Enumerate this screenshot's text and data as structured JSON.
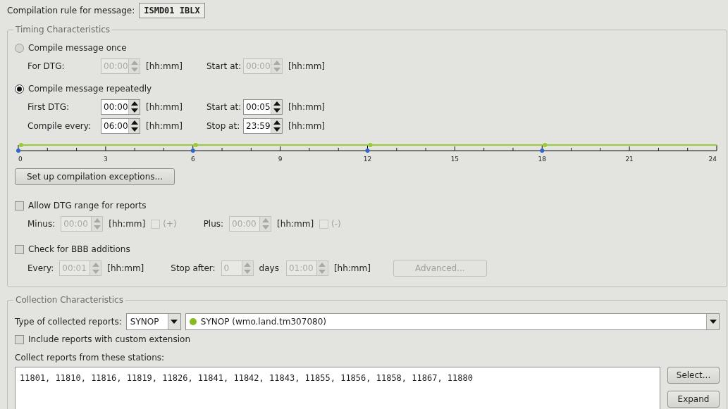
{
  "header": {
    "label": "Compilation rule for message:",
    "value": "ISMD01 IBLX"
  },
  "timing": {
    "title": "Timing Characteristics",
    "modes": [
      {
        "label": "Compile message once",
        "selected": false,
        "rows": [
          [
            {
              "label": "For DTG:",
              "value": "00:00",
              "unit": "[hh:mm]",
              "disabled": true
            },
            {
              "label": "Start at:",
              "value": "00:00",
              "unit": "[hh:mm]",
              "disabled": true
            }
          ]
        ]
      },
      {
        "label": "Compile message repeatedly",
        "selected": true,
        "rows": [
          [
            {
              "label": "First DTG:",
              "value": "00:00",
              "unit": "[hh:mm]",
              "disabled": false
            },
            {
              "label": "Start at:",
              "value": "00:05",
              "unit": "[hh:mm]",
              "disabled": false
            }
          ],
          [
            {
              "label": "Compile every:",
              "value": "06:00",
              "unit": "[hh:mm]",
              "disabled": false
            },
            {
              "label": "Stop at:",
              "value": "23:59",
              "unit": "[hh:mm]",
              "disabled": false
            }
          ]
        ]
      }
    ],
    "timeline": {
      "ticks": [
        {
          "label": "0",
          "scheduled": true
        },
        {
          "label": "3",
          "scheduled": false
        },
        {
          "label": "6",
          "scheduled": true
        },
        {
          "label": "9",
          "scheduled": false
        },
        {
          "label": "12",
          "scheduled": true
        },
        {
          "label": "15",
          "scheduled": false
        },
        {
          "label": "18",
          "scheduled": true
        },
        {
          "label": "21",
          "scheduled": false
        },
        {
          "label": "24",
          "scheduled": false
        }
      ]
    },
    "exceptions_button": "Set up compilation exceptions...",
    "options": [
      {
        "label": "Allow DTG range for reports",
        "checked": false,
        "fields": [
          {
            "kind": "spin",
            "label": "Minus:",
            "value": "00:00",
            "unit": "[hh:mm]",
            "disabled": true
          },
          {
            "kind": "check",
            "label": "(+)",
            "checked": false,
            "disabled": true
          },
          {
            "kind": "spin",
            "label": "Plus:",
            "value": "00:00",
            "unit": "[hh:mm]",
            "disabled": true
          },
          {
            "kind": "check",
            "label": "(-)",
            "checked": false,
            "disabled": true
          }
        ]
      },
      {
        "label": "Check for BBB additions",
        "checked": false,
        "fields": [
          {
            "kind": "spin",
            "label": "Every:",
            "value": "00:01",
            "unit": "[hh:mm]",
            "disabled": true
          },
          {
            "kind": "spin",
            "label": "Stop after:",
            "value": "0",
            "unit": "days",
            "disabled": true
          },
          {
            "kind": "spin",
            "value": "01:00",
            "unit": "[hh:mm]",
            "disabled": true
          },
          {
            "kind": "button",
            "label": "Advanced...",
            "disabled": true
          }
        ]
      }
    ]
  },
  "collection": {
    "title": "Collection Characteristics",
    "type_label": "Type of collected reports:",
    "type_value": "SYNOP",
    "template": {
      "label": "SYNOP (wmo.land.tm307080)",
      "color": "#88bb22"
    },
    "custom_extension": {
      "label": "Include reports with custom extension",
      "checked": false
    },
    "stations_label": "Collect reports from these stations:",
    "stations": "11801, 11810, 11816, 11819, 11826, 11841, 11842, 11843, 11855, 11856, 11858, 11867, 11880",
    "buttons": [
      "Select...",
      "Expand"
    ]
  }
}
